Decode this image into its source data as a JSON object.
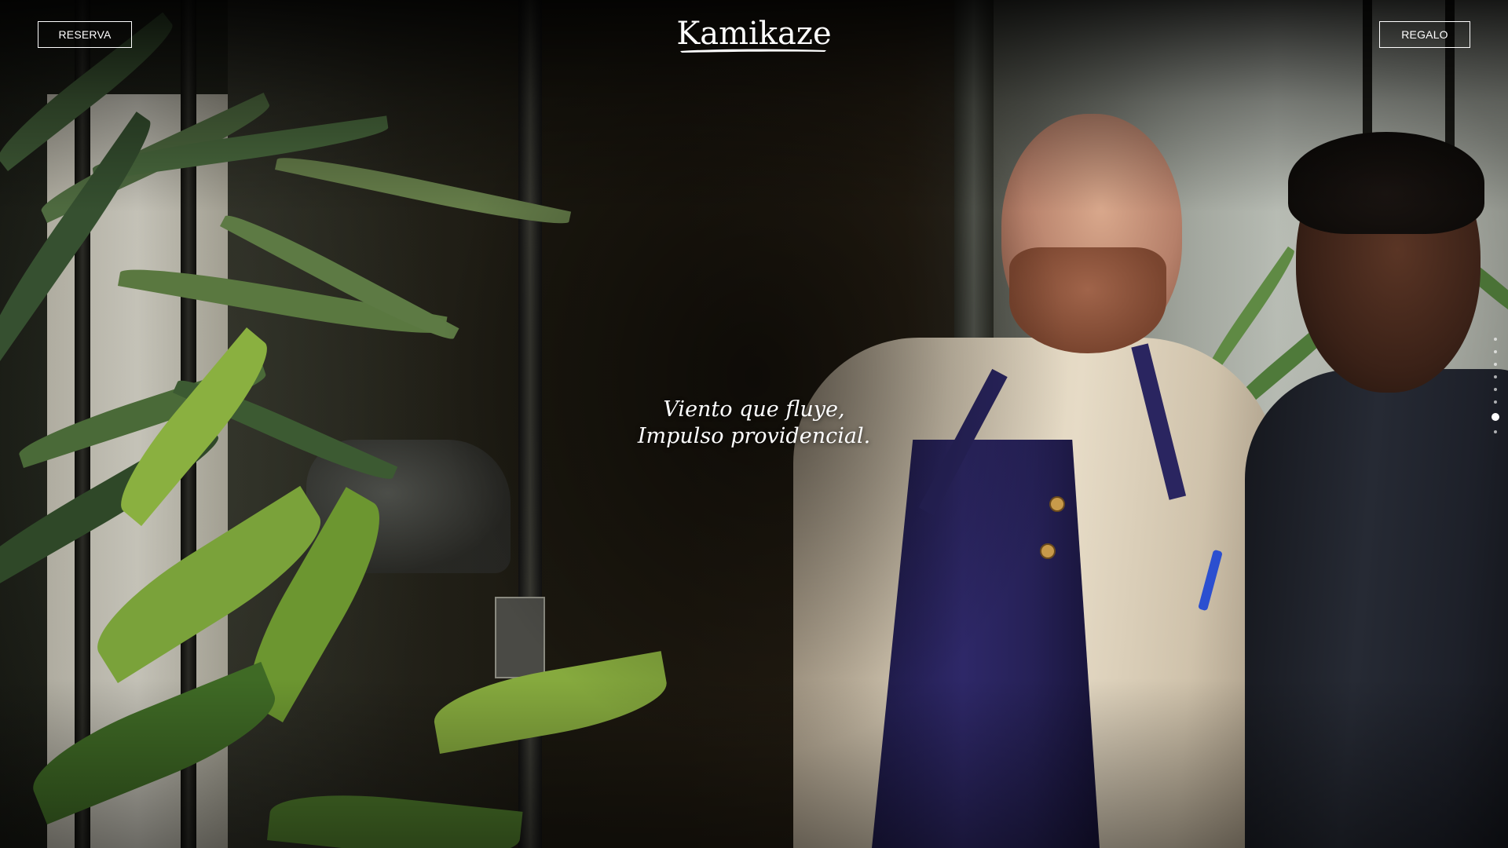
{
  "header": {
    "reserve_label": "RESERVA",
    "logo_text": "Kamikaze",
    "gift_label": "REGALO"
  },
  "hero": {
    "tagline_line1": "Viento que fluye,",
    "tagline_line2": "Impulso providencial.",
    "image_alt": "two-chefs-photo"
  },
  "slider": {
    "dot_count": 8,
    "active_index": 6
  },
  "colors": {
    "text": "#ffffff",
    "background": "#0b0a07",
    "apron": "#2e2868"
  }
}
